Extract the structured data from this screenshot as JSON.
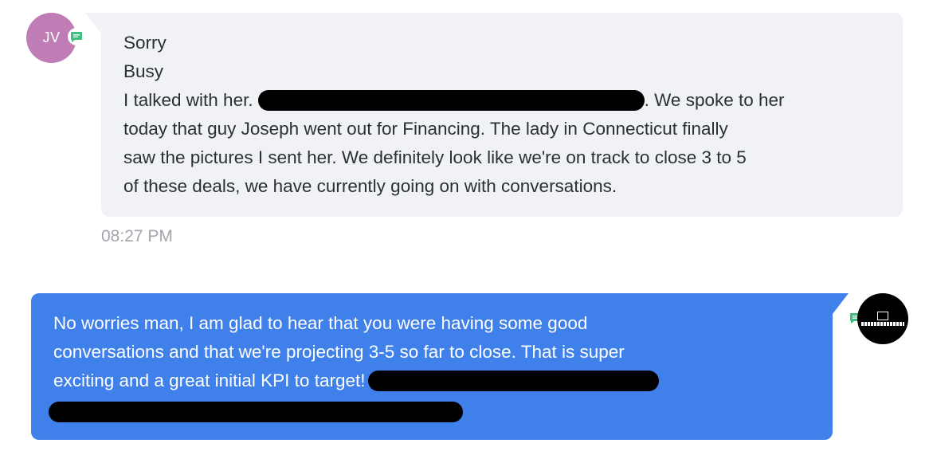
{
  "incoming": {
    "avatar_initials": "JV",
    "badge_icon": "chat-bubble-icon",
    "lines": [
      "Sorry",
      "Busy",
      "I talked with her.",
      ". We spoke to her",
      "today that guy Joseph went out for Financing. The lady in Connecticut finally",
      "saw the pictures I sent her. We definitely look like we're on track to close 3 to 5",
      "of these deals, we have currently going on with conversations."
    ],
    "timestamp": "08:27 PM"
  },
  "outgoing": {
    "avatar_icon": "brand-logo-icon",
    "badge_icon": "chat-bubble-icon",
    "lines": [
      "No worries man, I am glad to hear that you were having some good",
      "conversations and that we're projecting 3-5 so far to close. That is super",
      "exciting and a great initial KPI to target!"
    ]
  },
  "colors": {
    "incoming_bubble": "#f1f2f5",
    "outgoing_bubble": "#3f80ea",
    "avatar_jv": "#c07cb4",
    "badge_green": "#3fbf7f"
  }
}
